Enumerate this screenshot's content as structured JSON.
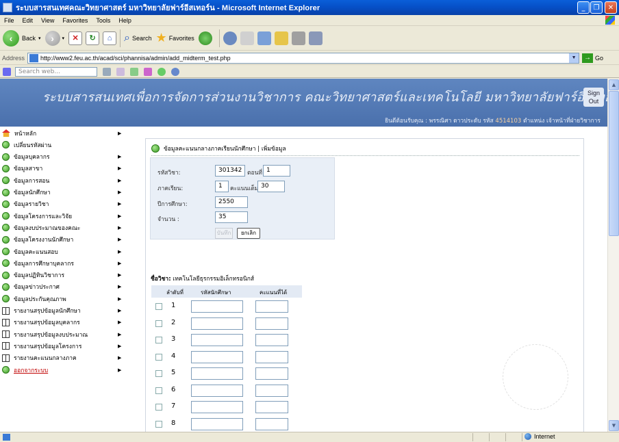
{
  "window": {
    "title": "ระบบสารสนเทศคณะวิทยาศาสตร์ มหาวิทยาลัยฟาร์อีสเทอร์น - Microsoft Internet Explorer",
    "min_label": "_",
    "max_label": "❐",
    "close_label": "✕"
  },
  "menu": [
    "File",
    "Edit",
    "View",
    "Favorites",
    "Tools",
    "Help"
  ],
  "toolbar": {
    "back_label": "Back",
    "search_label": "Search",
    "favorites_label": "Favorites"
  },
  "address": {
    "label": "Address",
    "url": "http://www2.feu.ac.th/acad/sci/phannisa/admin/add_midterm_test.php",
    "go_label": "Go"
  },
  "search_toolbar": {
    "placeholder": "Search web..."
  },
  "banner": {
    "title": "ระบบสารสนเทศเพื่อการจัดการส่วนงานวิชาการ คณะวิทยาศาสตร์และเทคโนโลยี มหาวิทยาลัยฟาร์อีสเทอร์น",
    "sign_out": "Sign Out",
    "welcome": "ยินดีต้อนรับคุณ : พรรณิศา ดาวประดับ รหัส",
    "user_id": "4514103",
    "position_label": "ตำแหน่ง",
    "position": "เจ้าหน้าที่ฝ่ายวิชาการ"
  },
  "sidebar": {
    "items": [
      {
        "label": "หน้าหลัก",
        "icon": "home-icon",
        "arrow": true
      },
      {
        "label": "เปลี่ยนรหัสผ่าน",
        "icon": "circle-icon",
        "arrow": false
      },
      {
        "label": "ข้อมูลบุคลากร",
        "icon": "circle-icon",
        "arrow": true
      },
      {
        "label": "ข้อมูลสาขา",
        "icon": "circle-icon",
        "arrow": true
      },
      {
        "label": "ข้อมูลการสอน",
        "icon": "circle-icon",
        "arrow": true
      },
      {
        "label": "ข้อมูลนักศึกษา",
        "icon": "circle-icon",
        "arrow": true
      },
      {
        "label": "ข้อมูลรายวิชา",
        "icon": "circle-icon",
        "arrow": true
      },
      {
        "label": "ข้อมูลโครงการและวิจัย",
        "icon": "circle-icon",
        "arrow": true
      },
      {
        "label": "ข้อมูลงบประมาณของคณะ",
        "icon": "circle-icon",
        "arrow": true
      },
      {
        "label": "ข้อมูลโครงงานนักศึกษา",
        "icon": "circle-icon",
        "arrow": true
      },
      {
        "label": "ข้อมูลคะแนนสอบ",
        "icon": "circle-icon",
        "arrow": true
      },
      {
        "label": "ข้อมูลการศึกษาบุคลากร",
        "icon": "circle-icon",
        "arrow": true
      },
      {
        "label": "ข้อมูลปฏิทินวิชาการ",
        "icon": "circle-icon",
        "arrow": true
      },
      {
        "label": "ข้อมูลข่าวประกาศ",
        "icon": "circle-icon",
        "arrow": true
      },
      {
        "label": "ข้อมูลประกันคุณภาพ",
        "icon": "circle-icon",
        "arrow": true
      },
      {
        "label": "รายงานสรุปข้อมูลนักศึกษา",
        "icon": "book-icon",
        "arrow": true
      },
      {
        "label": "รายงานสรุปข้อมูลบุคลากร",
        "icon": "book-icon",
        "arrow": true
      },
      {
        "label": "รายงานสรุปข้อมูลงบประมาณ",
        "icon": "book-icon",
        "arrow": true
      },
      {
        "label": "รายงานสรุปข้อมูลโครงการ",
        "icon": "book-icon",
        "arrow": true
      },
      {
        "label": "รายงานคะแนนกลางภาค",
        "icon": "book-icon",
        "arrow": true
      },
      {
        "label": "ออกจากระบบ",
        "icon": "circle-icon",
        "arrow": true
      }
    ]
  },
  "panel": {
    "breadcrumb": "ข้อมูลคะแนนกลางภาคเรียนนักศึกษา | เพิ่มข้อมูล",
    "form": {
      "course_code_label": "รหัสวิชา:",
      "course_code": "301342",
      "section_label": "ตอนที่",
      "section": "1",
      "semester_label": "ภาคเรียน:",
      "semester": "1",
      "full_score_label": "คะแนนเต็ม",
      "full_score": "30",
      "year_label": "ปีการศึกษา:",
      "year": "2550",
      "count_label": "จำนวน :",
      "count": "35",
      "save_label": "บันทึก",
      "cancel_label": "ยกเลิก"
    },
    "course_name_label": "ชื่อวิชา:",
    "course_name": "เทคโนโลยีธุรกรรมอิเล็กทรอนิกส์",
    "table": {
      "headers": [
        "ลำดับที่",
        "รหัสนักศึกษา",
        "คะแนนที่ได้"
      ],
      "rows": [
        "1",
        "2",
        "3",
        "4",
        "5",
        "6",
        "7",
        "8"
      ]
    }
  },
  "status": {
    "zone": "Internet"
  }
}
